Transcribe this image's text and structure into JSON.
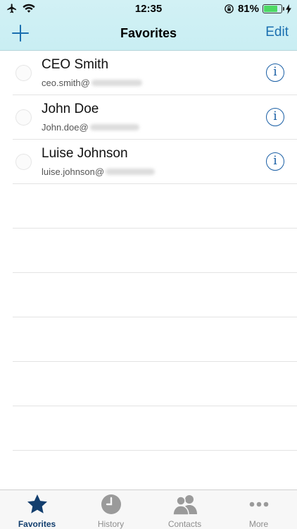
{
  "status": {
    "time": "12:35",
    "battery_percent": "81%",
    "battery_level": 0.81
  },
  "nav": {
    "title": "Favorites",
    "edit_label": "Edit"
  },
  "contacts": [
    {
      "name": "CEO Smith",
      "email": "ceo.smith@"
    },
    {
      "name": "John Doe",
      "email": "John.doe@"
    },
    {
      "name": "Luise Johnson",
      "email": "luise.johnson@"
    }
  ],
  "tabs": [
    {
      "label": "Favorites",
      "icon": "star-icon",
      "active": true
    },
    {
      "label": "History",
      "icon": "clock-icon",
      "active": false
    },
    {
      "label": "Contacts",
      "icon": "contacts-icon",
      "active": false
    },
    {
      "label": "More",
      "icon": "more-icon",
      "active": false
    }
  ],
  "colors": {
    "accent": "#1a6fb0",
    "active_tab": "#123e6e",
    "header_bg": "#c9eef3",
    "battery": "#4cd964"
  }
}
